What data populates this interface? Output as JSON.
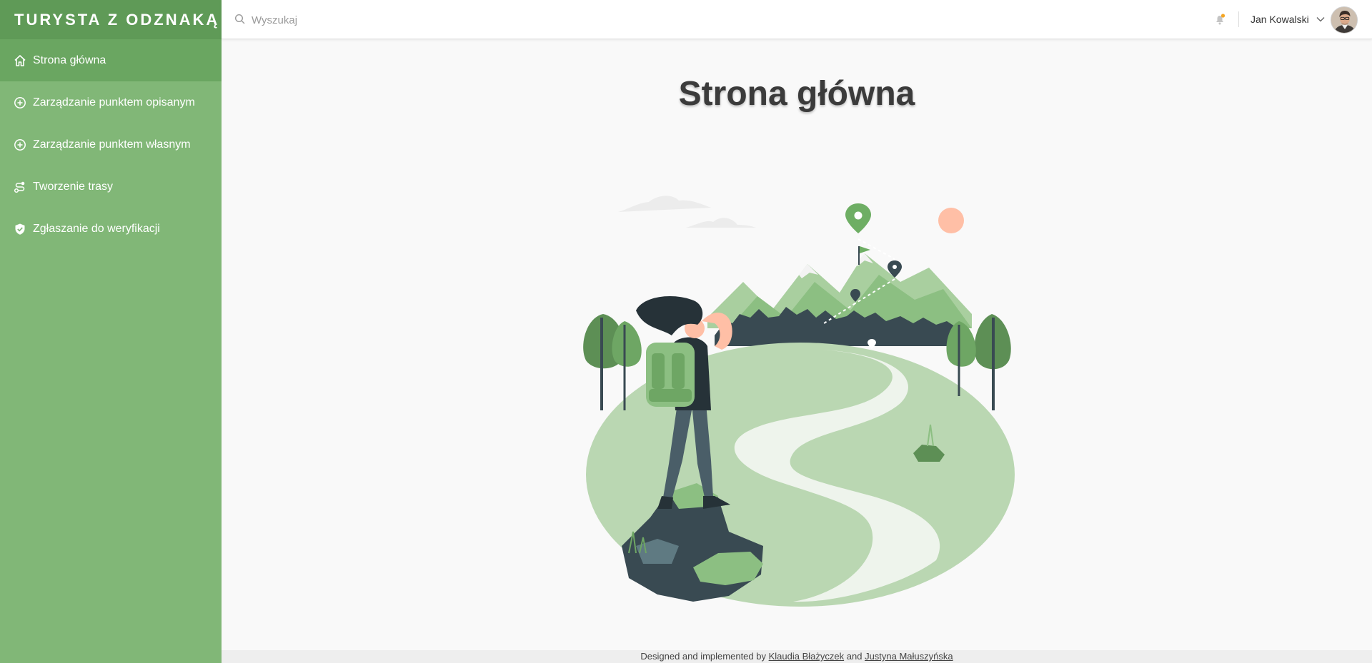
{
  "app": {
    "brand": "TURYSTA Z ODZNAKĄ"
  },
  "sidebar": {
    "items": [
      {
        "label": "Strona główna",
        "icon": "home-icon"
      },
      {
        "label": "Zarządzanie punktem opisanym",
        "icon": "plus-circle-icon"
      },
      {
        "label": "Zarządzanie punktem własnym",
        "icon": "plus-circle-icon"
      },
      {
        "label": "Tworzenie trasy",
        "icon": "route-icon"
      },
      {
        "label": "Zgłaszanie do weryfikacji",
        "icon": "shield-check-icon"
      }
    ]
  },
  "header": {
    "search_placeholder": "Wyszukaj",
    "user_name": "Jan Kowalski"
  },
  "main": {
    "title": "Strona główna"
  },
  "footer": {
    "prefix": "Designed and implemented by",
    "author1": "Klaudia Błażyczek",
    "joiner": "and",
    "author2": "Justyna Małuszyńska"
  },
  "colors": {
    "sidebar_bg": "#81b777",
    "brand_bg": "#5f9a57",
    "active_bg": "#6aa661",
    "notification_dot": "#f5a623"
  }
}
